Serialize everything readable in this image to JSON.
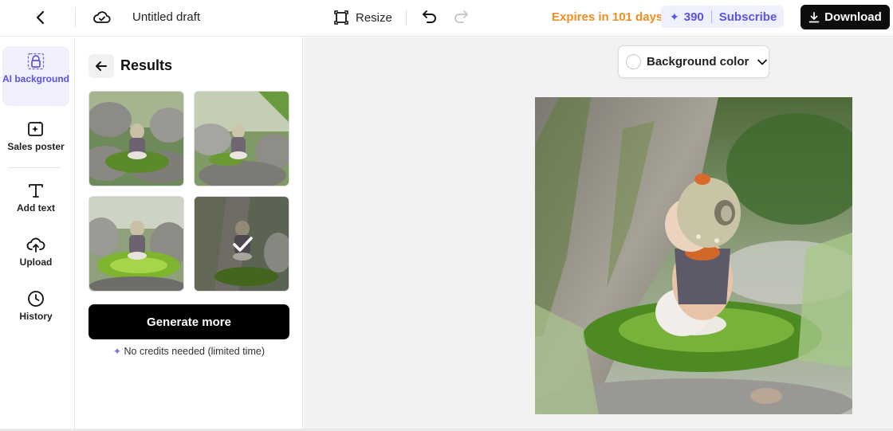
{
  "topbar": {
    "title": "Untitled draft",
    "resize_label": "Resize",
    "expires_text": "Expires in 101 days",
    "credits_count": "390",
    "subscribe_label": "Subscribe",
    "download_label": "Download"
  },
  "rail": {
    "items": [
      {
        "label": "AI background",
        "icon": "ai-background-icon"
      },
      {
        "label": "Sales poster",
        "icon": "sales-poster-icon"
      },
      {
        "label": "Add text",
        "icon": "text-icon"
      },
      {
        "label": "Upload",
        "icon": "upload-icon"
      },
      {
        "label": "History",
        "icon": "clock-icon"
      }
    ]
  },
  "results": {
    "heading": "Results",
    "thumbnails": [
      {
        "id": 1,
        "selected": false
      },
      {
        "id": 2,
        "selected": false
      },
      {
        "id": 3,
        "selected": false
      },
      {
        "id": 4,
        "selected": true
      }
    ],
    "generate_label": "Generate more",
    "note": "No credits needed (limited time)"
  },
  "canvas": {
    "bg_color_label": "Background color"
  },
  "colors": {
    "accent": "#5a52e6",
    "expires": "#f28c1c",
    "canvas_bg": "#f2f2f2",
    "button_dark": "#0d0d0d"
  }
}
